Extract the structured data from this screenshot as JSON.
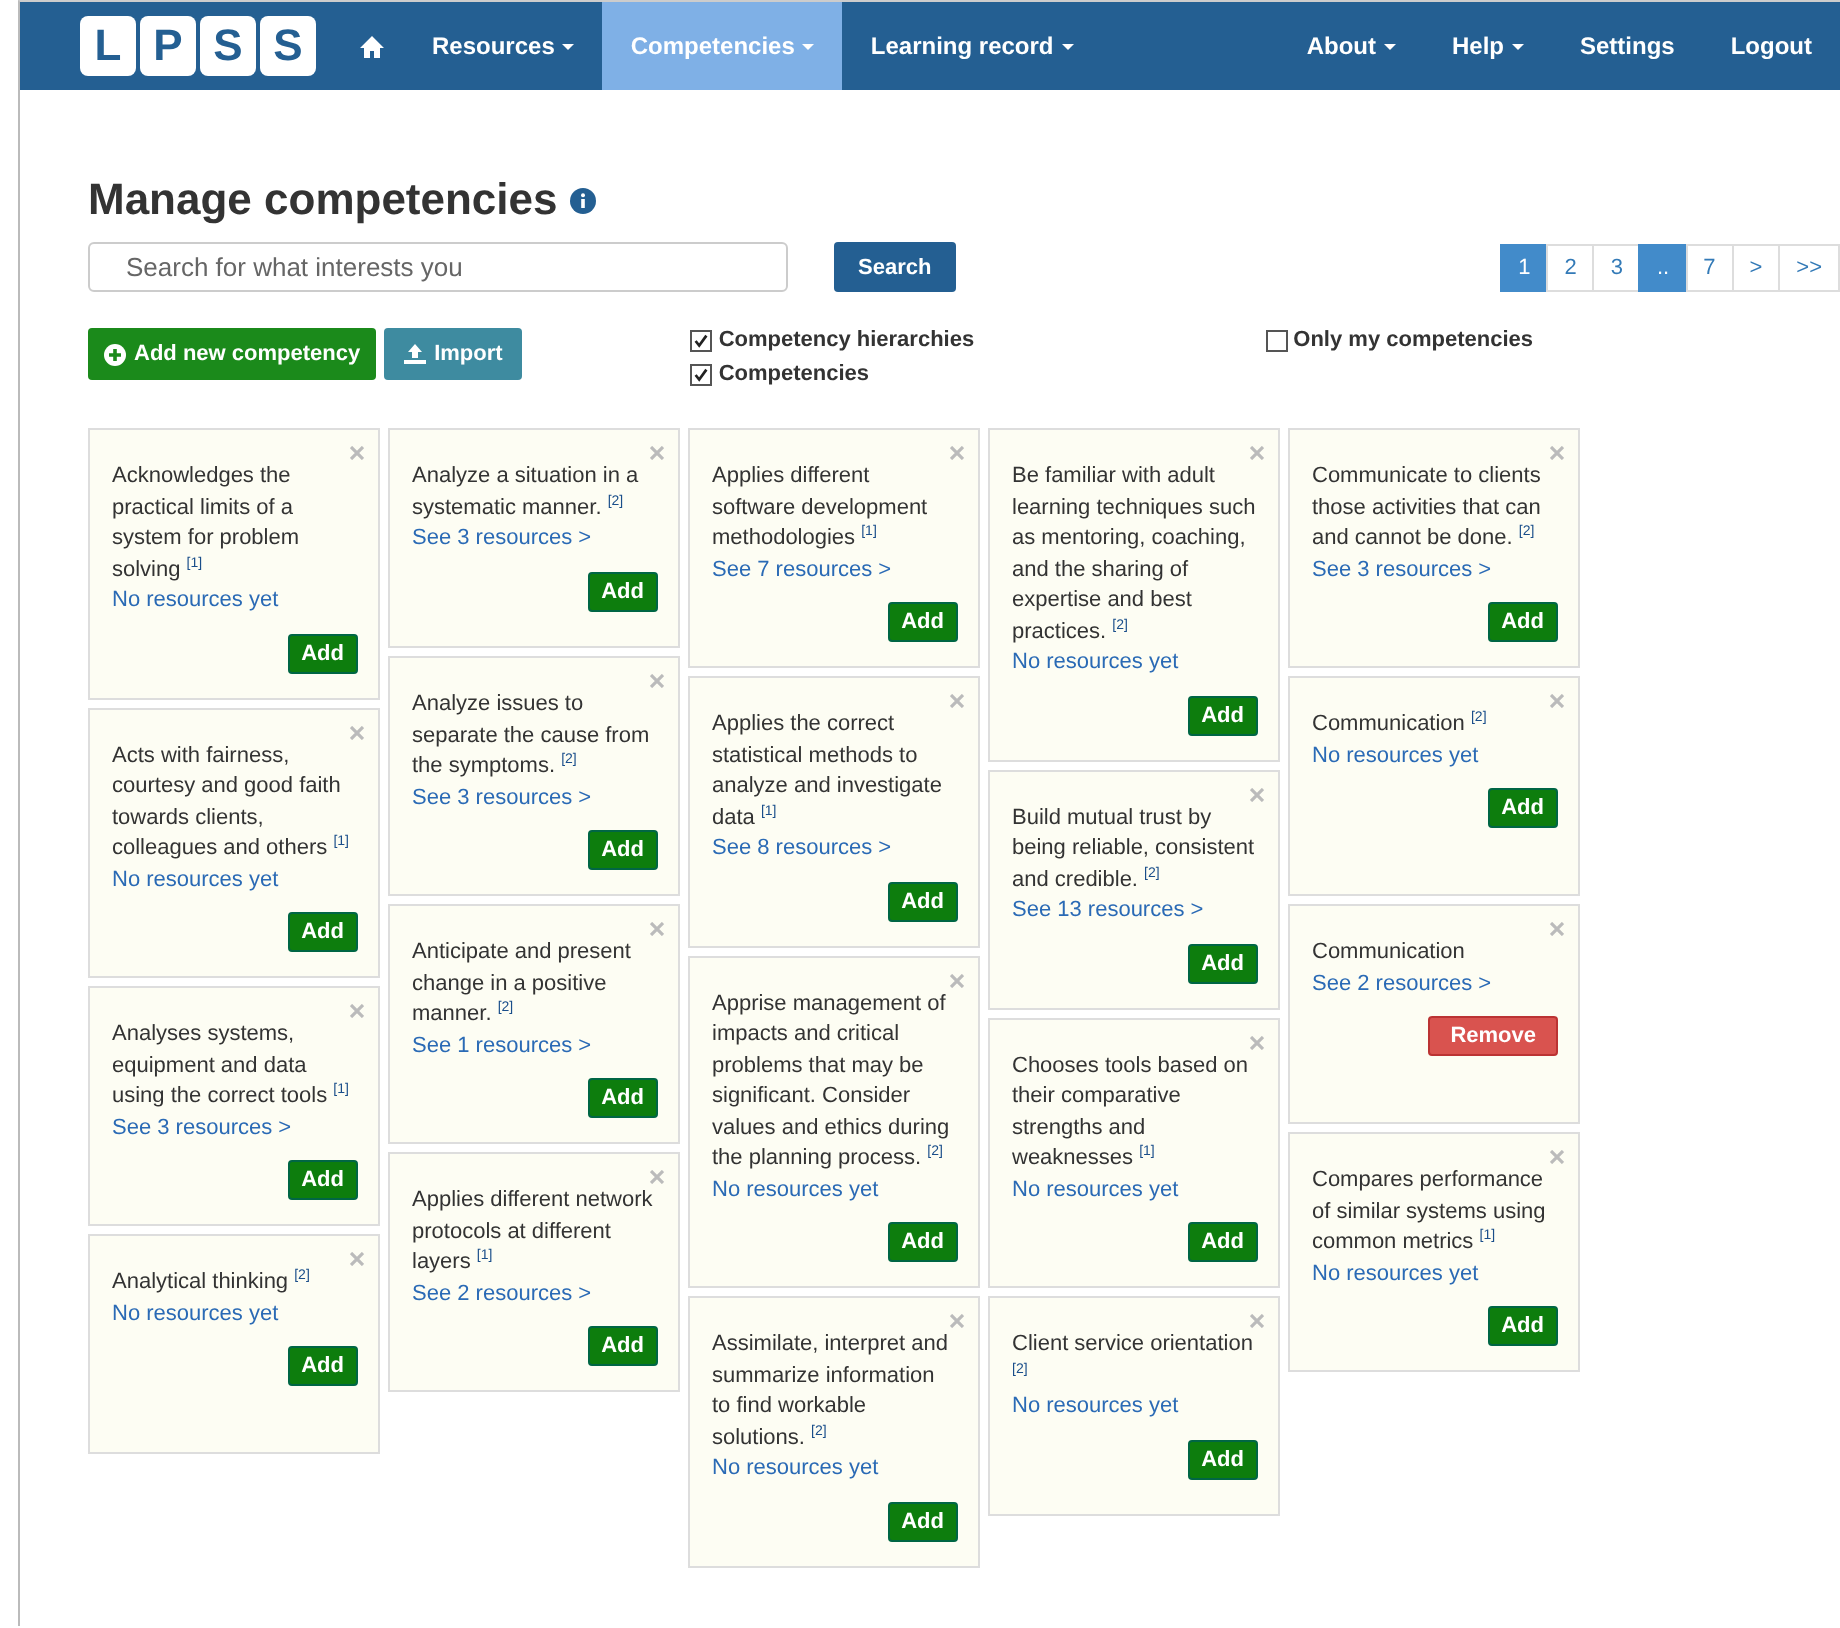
{
  "navbar": {
    "logo": [
      "L",
      "P",
      "S",
      "S"
    ],
    "left_items": [
      {
        "label": "Resources",
        "dropdown": true,
        "selected": false
      },
      {
        "label": "Competencies",
        "dropdown": true,
        "selected": true
      },
      {
        "label": "Learning record",
        "dropdown": true,
        "selected": false
      }
    ],
    "right_items": [
      {
        "label": "About",
        "dropdown": true,
        "selected": false
      },
      {
        "label": "Help",
        "dropdown": true,
        "selected": false
      },
      {
        "label": "Settings",
        "dropdown": false,
        "selected": false
      },
      {
        "label": "Logout",
        "dropdown": false,
        "selected": false
      }
    ]
  },
  "title": "Manage competencies",
  "search": {
    "placeholder": "Search for what interests you",
    "button": "Search"
  },
  "pagination": [
    {
      "label": "1",
      "selected": true
    },
    {
      "label": "2",
      "selected": false
    },
    {
      "label": "3",
      "selected": false
    },
    {
      "label": "..",
      "selected": true
    },
    {
      "label": "7",
      "selected": false
    },
    {
      "label": ">",
      "selected": false
    },
    {
      "label": ">>",
      "selected": false
    }
  ],
  "actions": {
    "add_new": "Add new competency",
    "import": "Import"
  },
  "filters": [
    {
      "label": "Competency hierarchies",
      "checked": true
    },
    {
      "label": "Competencies",
      "checked": true
    },
    {
      "label": "Only my competencies",
      "checked": false
    }
  ],
  "columns": [
    {
      "cards": [
        {
          "text": "Acknowledges the practical limits of a system for problem solving $^{[1]}$",
          "link": "No resources yet",
          "button": {
            "kind": "add",
            "label": "Add"
          }
        },
        {
          "text": "Acts with fairness, courtesy and good faith towards clients, colleagues and others $^{[1]}$",
          "link": "No resources yet",
          "button": {
            "kind": "add",
            "label": "Add"
          }
        },
        {
          "text": "Analyses systems, equipment and data using the correct tools $^{[1]}$",
          "link": "See 3 resources >",
          "button": {
            "kind": "add",
            "label": "Add"
          }
        },
        {
          "text": "Analytical thinking $^{[2]}$",
          "link": "No resources yet",
          "button": {
            "kind": "add",
            "label": "Add"
          }
        }
      ]
    },
    {
      "cards": [
        {
          "text": "Analyze a situation in a systematic manner. $^{[2]}$",
          "link": "See 3 resources >",
          "button": {
            "kind": "add",
            "label": "Add"
          }
        },
        {
          "text": "Analyze issues to separate the cause from the symptoms. $^{[2]}$",
          "link": "See 3 resources >",
          "button": {
            "kind": "add",
            "label": "Add"
          }
        },
        {
          "text": "Anticipate and present change in a positive manner. $^{[2]}$",
          "link": "See 1 resources >",
          "button": {
            "kind": "add",
            "label": "Add"
          }
        },
        {
          "text": "Applies different network protocols at different layers $^{[1]}$",
          "link": "See 2 resources >",
          "button": {
            "kind": "add",
            "label": "Add"
          }
        }
      ]
    },
    {
      "cards": [
        {
          "text": "Applies different software development methodologies $^{[1]}$",
          "link": "See 7 resources >",
          "button": {
            "kind": "add",
            "label": "Add"
          }
        },
        {
          "text": "Applies the correct statistical methods to analyze and investigate data $^{[1]}$",
          "link": "See 8 resources >",
          "button": {
            "kind": "add",
            "label": "Add"
          }
        },
        {
          "text": "Apprise management of impacts and critical problems that may be significant. Consider values and ethics during the planning process. $^{[2]}$",
          "link": "No resources yet",
          "button": {
            "kind": "add",
            "label": "Add"
          }
        },
        {
          "text": "Assimilate, interpret and summarize information to find workable solutions. $^{[2]}$",
          "link": "No resources yet",
          "button": {
            "kind": "add",
            "label": "Add"
          }
        }
      ]
    },
    {
      "cards": [
        {
          "text": "Be familiar with adult learning techniques such as mentoring, coaching, and the sharing of expertise and best practices. $^{[2]}$",
          "link": "No resources yet",
          "button": {
            "kind": "add",
            "label": "Add"
          }
        },
        {
          "text": "Build mutual trust by being reliable, consistent and credible. $^{[2]}$",
          "link": "See 13 resources >",
          "button": {
            "kind": "add",
            "label": "Add"
          }
        },
        {
          "text": "Chooses tools based on their comparative strengths and weaknesses $^{[1]}$",
          "link": "No resources yet",
          "button": {
            "kind": "add",
            "label": "Add"
          }
        },
        {
          "text": "Client service orientation $^{[2]}$",
          "link": "No resources yet",
          "button": {
            "kind": "add",
            "label": "Add"
          }
        }
      ]
    },
    {
      "cards": [
        {
          "text": "Communicate to clients those activities that can and cannot be done. $^{[2]}$",
          "link": "See 3 resources >",
          "button": {
            "kind": "add",
            "label": "Add"
          }
        },
        {
          "text": "Communication $^{[2]}$",
          "link": "No resources yet",
          "button": {
            "kind": "add",
            "label": "Add"
          }
        },
        {
          "text": "Communication",
          "link": "See 2 resources >",
          "button": {
            "kind": "remove",
            "label": "Remove"
          }
        },
        {
          "text": "Compares performance of similar systems using common metrics $^{[1]}$",
          "link": "No resources yet",
          "button": {
            "kind": "add",
            "label": "Add"
          }
        }
      ]
    }
  ]
}
